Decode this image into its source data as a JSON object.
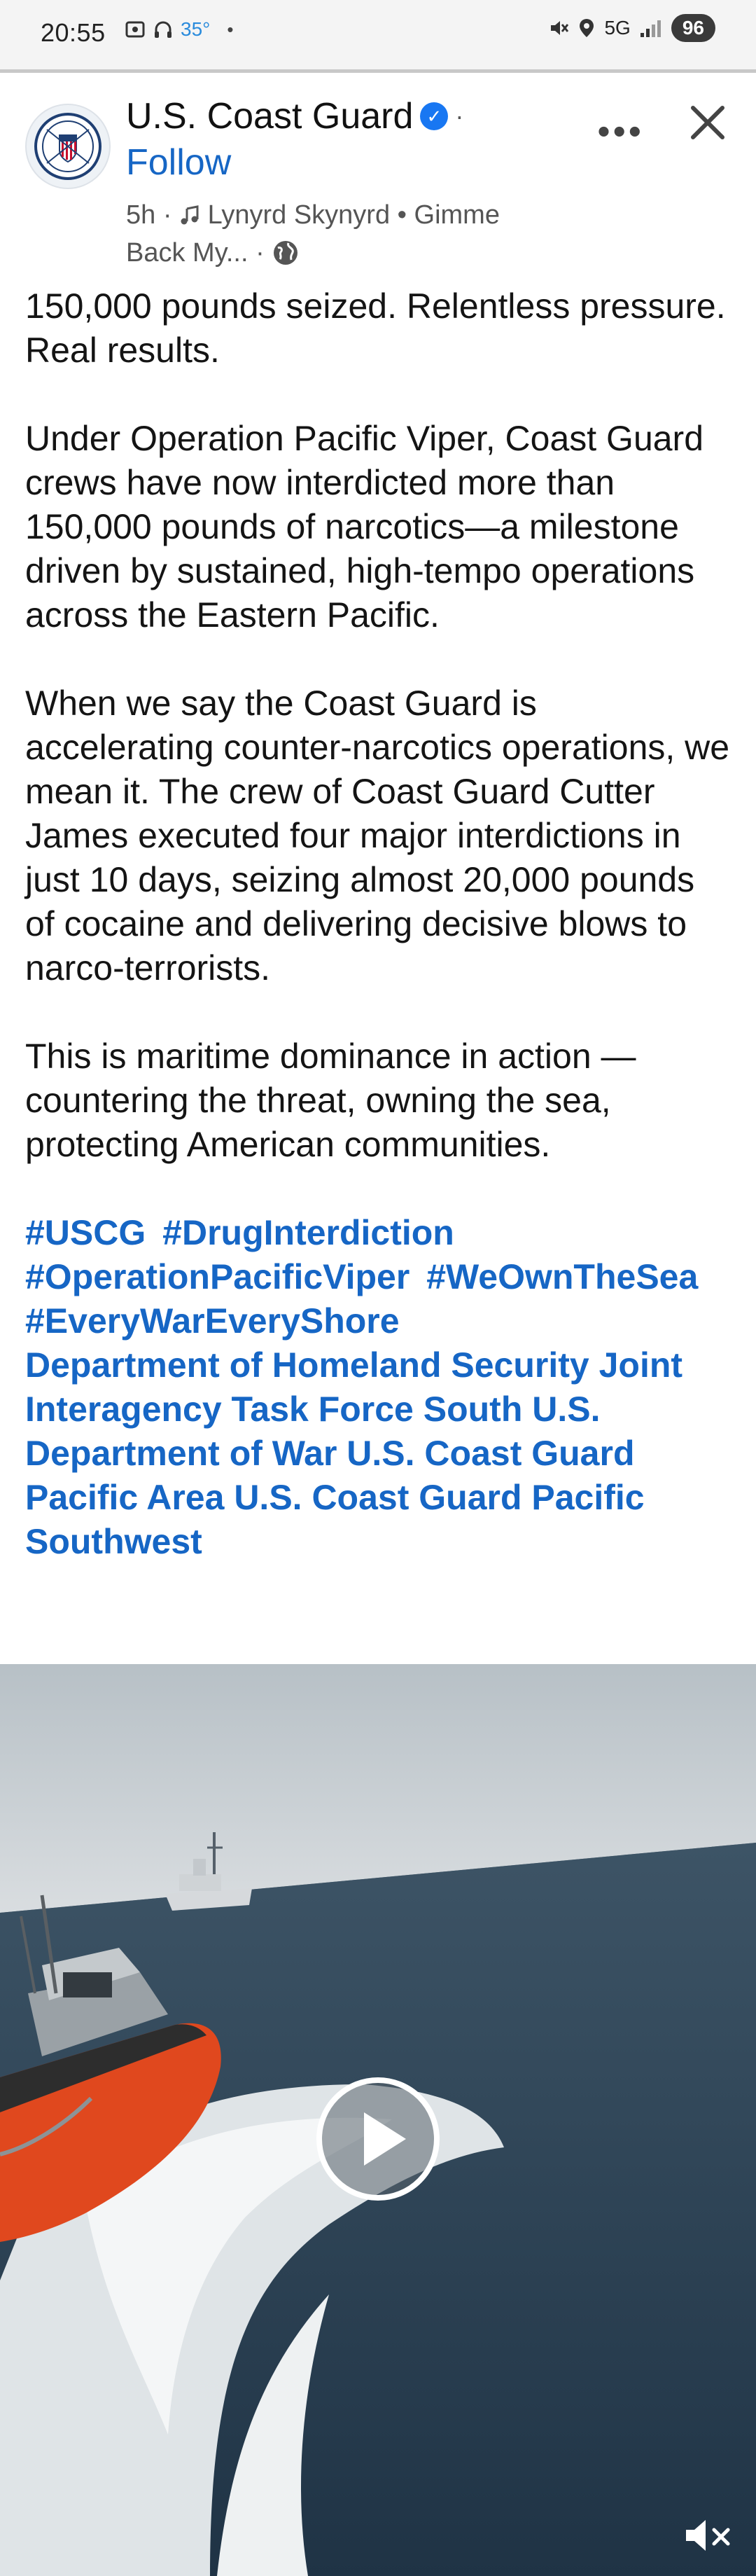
{
  "status_bar": {
    "time": "20:55",
    "temperature": "35°",
    "network": "5G",
    "battery": "96",
    "icons": [
      "screenshot-icon",
      "headphones-icon",
      "mute-icon",
      "location-icon",
      "signal-icon"
    ]
  },
  "post": {
    "author": "U.S. Coast Guard",
    "follow_label": "Follow",
    "time_ago": "5h",
    "separator": "·",
    "music": "Lynyrd Skynyrd • Gimme Back My...",
    "privacy_icon": "globe-icon",
    "paragraphs": [
      "150,000 pounds seized. Relentless pressure. Real results.",
      "Under Operation Pacific Viper, Coast Guard crews have now interdicted more than 150,000 pounds of narcotics—a milestone driven by sustained, high-tempo operations across the Eastern Pacific.",
      "When we say the Coast Guard is accelerating counter-narcotics operations, we mean it. The crew of Coast Guard Cutter James executed four major interdictions in just 10 days, seizing almost 20,000 pounds of cocaine and delivering decisive blows to narco-terrorists.",
      "This is maritime dominance in action — countering the threat, owning the sea, protecting American communities."
    ],
    "hashtags": [
      "#USCG",
      "#DrugInterdiction",
      "#OperationPacificViper",
      "#WeOwnTheSea",
      "#EveryWarEveryShore"
    ],
    "mentions": "Department of Homeland Security Joint Interagency Task Force South U.S. Department of War U.S. Coast Guard Pacific Area U.S. Coast Guard Pacific Southwest"
  },
  "colors": {
    "link": "#1666c5",
    "verified": "#1877f2",
    "boat_hull": "#e0481e",
    "sea": "#24394b"
  }
}
